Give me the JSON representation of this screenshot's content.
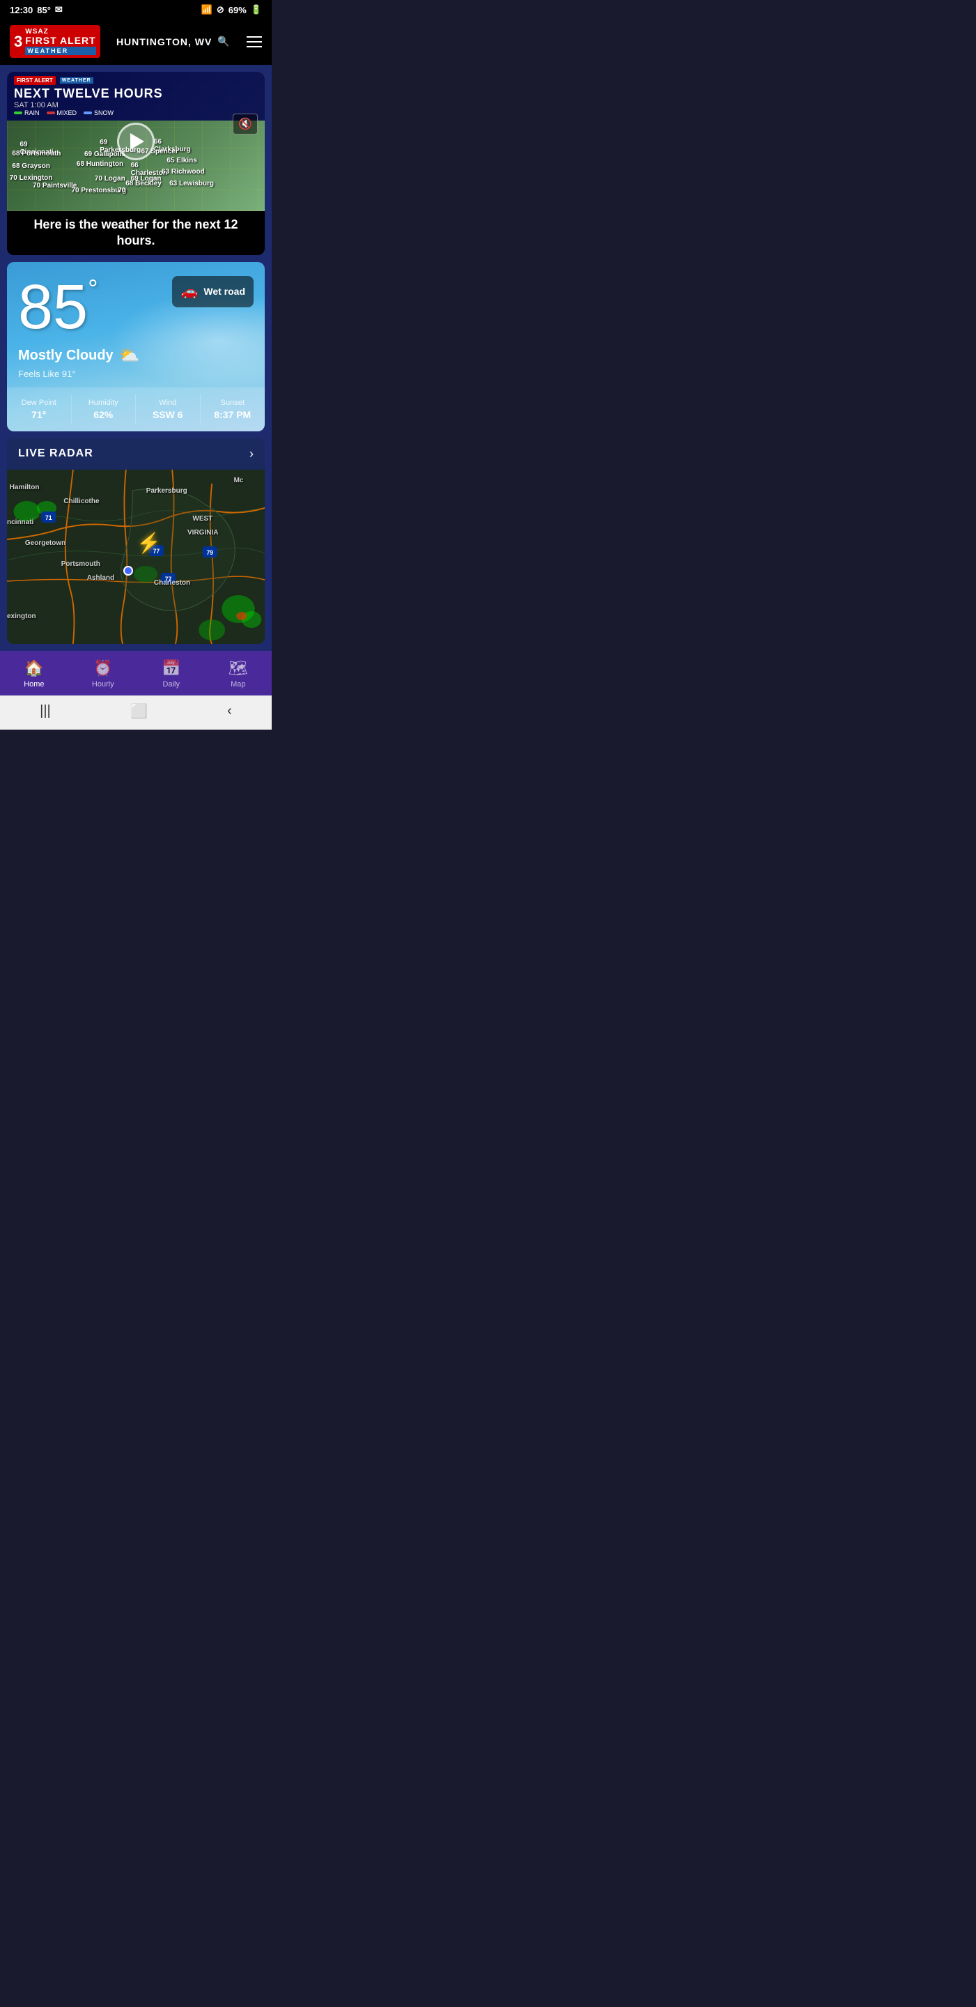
{
  "statusBar": {
    "time": "12:30",
    "temp": "85°",
    "battery": "69%",
    "wifiIcon": "wifi",
    "notifIcon": "⊘"
  },
  "header": {
    "location": "HUNTINGTON, WV",
    "searchIcon": "🔍",
    "menuIcon": "☰"
  },
  "logo": {
    "number": "3",
    "first": "WSAZ",
    "alert": "FIRST ALERT",
    "weather": "WEATHER"
  },
  "videoCard": {
    "badge": "FIRST ALERT",
    "badgeWeather": "WEATHER",
    "title": "NEXT TWELVE HOURS",
    "subtitle": "SAT 1:00 AM",
    "legend": [
      {
        "label": "RAIN",
        "color": "#33cc33"
      },
      {
        "label": "MIXED",
        "color": "#cc3333"
      },
      {
        "label": "SNOW",
        "color": "#6699ff"
      }
    ],
    "caption": "Here is the weather for the next 12 hours.",
    "tempLabels": [
      {
        "text": "69 Cincinnati",
        "top": "22%",
        "left": "8%"
      },
      {
        "text": "68 Portsmouth",
        "top": "32%",
        "left": "5%"
      },
      {
        "text": "68 Grayson",
        "top": "48%",
        "left": "5%"
      },
      {
        "text": "70 Lexington",
        "top": "60%",
        "left": "2%"
      },
      {
        "text": "70 Paintsville",
        "top": "68%",
        "left": "12%"
      },
      {
        "text": "69 Parkersburg",
        "top": "18%",
        "left": "38%"
      },
      {
        "text": "69 Gallipolis",
        "top": "32%",
        "left": "32%"
      },
      {
        "text": "68 Huntington",
        "top": "45%",
        "left": "28%"
      },
      {
        "text": "70 Logan",
        "top": "58%",
        "left": "35%"
      },
      {
        "text": "66 Charleston",
        "top": "45%",
        "left": "50%"
      },
      {
        "text": "69 Logan",
        "top": "60%",
        "left": "48%"
      },
      {
        "text": "66 Clarksburg",
        "top": "18%",
        "left": "58%"
      },
      {
        "text": "67 Spencer",
        "top": "30%",
        "left": "52%"
      },
      {
        "text": "65 Elkins",
        "top": "40%",
        "left": "62%"
      },
      {
        "text": "63 Richwood",
        "top": "52%",
        "left": "60%"
      },
      {
        "text": "68 Beckley",
        "top": "65%",
        "left": "48%"
      },
      {
        "text": "63 Lewisburg",
        "top": "65%",
        "left": "65%"
      },
      {
        "text": "70 Prestonsburg",
        "top": "72%",
        "left": "28%"
      },
      {
        "text": "70",
        "top": "72%",
        "left": "42%"
      }
    ]
  },
  "weather": {
    "temperature": "85",
    "unit": "°",
    "condition": "Mostly Cloudy",
    "feelsLike": "Feels Like 91°",
    "wetRoad": "Wet road",
    "dewPoint": {
      "label": "Dew Point",
      "value": "71°"
    },
    "humidity": {
      "label": "Humidity",
      "value": "62%"
    },
    "wind": {
      "label": "Wind",
      "value": "SSW 6"
    },
    "sunset": {
      "label": "Sunset",
      "value": "8:37 PM"
    }
  },
  "radar": {
    "title": "LIVE RADAR",
    "mapLabels": [
      {
        "text": "Hamilton",
        "top": "12%",
        "left": "1%"
      },
      {
        "text": "Chillicothe",
        "top": "18%",
        "left": "22%"
      },
      {
        "text": "Parkersburg",
        "top": "14%",
        "left": "56%"
      },
      {
        "text": "ncinnati",
        "top": "30%",
        "left": "0%"
      },
      {
        "text": "Georgetown",
        "top": "42%",
        "left": "8%"
      },
      {
        "text": "Portsmouth",
        "top": "50%",
        "left": "22%"
      },
      {
        "text": "Ashland",
        "top": "60%",
        "left": "32%"
      },
      {
        "text": "Charleston",
        "top": "64%",
        "left": "58%"
      },
      {
        "text": "exington",
        "top": "80%",
        "left": "0%"
      },
      {
        "text": "WEST",
        "top": "30%",
        "left": "73%"
      },
      {
        "text": "VIRGINIA",
        "top": "38%",
        "left": "71%"
      },
      {
        "text": "Mc",
        "top": "5%",
        "left": "88%"
      }
    ],
    "interstates": [
      "71",
      "77",
      "77",
      "79"
    ]
  },
  "bottomNav": {
    "items": [
      {
        "label": "Home",
        "icon": "🏠",
        "active": true
      },
      {
        "label": "Hourly",
        "icon": "⏰",
        "active": false
      },
      {
        "label": "Daily",
        "icon": "📅",
        "active": false
      },
      {
        "label": "Map",
        "icon": "🗺",
        "active": false
      }
    ]
  },
  "systemNav": {
    "backIcon": "<",
    "homeIcon": "☐",
    "recentIcon": "|||"
  }
}
